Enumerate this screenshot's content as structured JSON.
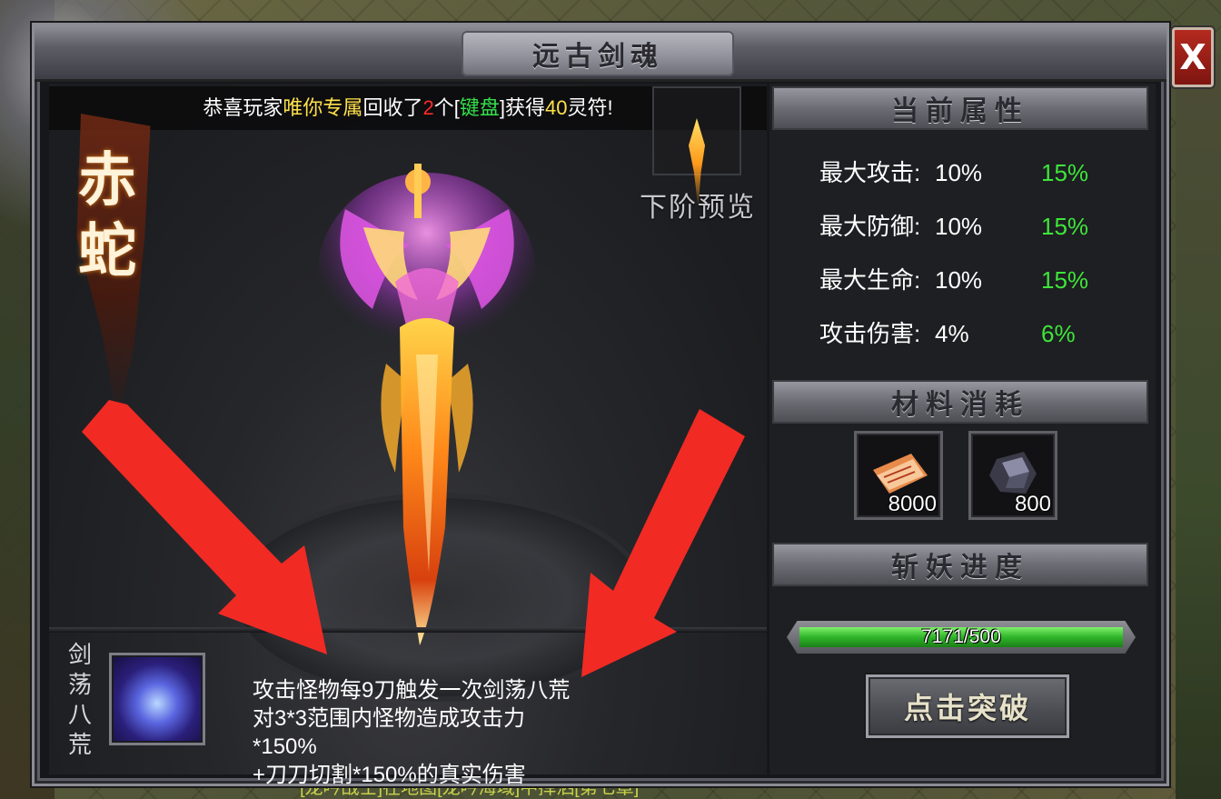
{
  "window": {
    "title": "远古剑魂",
    "close_label": "X"
  },
  "announcement": {
    "prefix": "恭喜玩家",
    "player": "唯你专属",
    "middle": "回收了",
    "count": "2",
    "unit": "个[",
    "item": "键盘",
    "after_item": "]获得",
    "reward": "40",
    "suffix": "灵符!"
  },
  "weapon": {
    "name_line1": "赤",
    "name_line2": "蛇"
  },
  "preview": {
    "label": "下阶预览"
  },
  "skill": {
    "name": "剑荡八荒",
    "description": [
      "攻击怪物每9刀触发一次剑荡八荒",
      "对3*3范围内怪物造成攻击力",
      "*150%",
      "+刀刀切割*150%的真实伤害"
    ]
  },
  "attributes": {
    "header": "当前属性",
    "rows": [
      {
        "label": "最大攻击:",
        "current": "10%",
        "next": "15%"
      },
      {
        "label": "最大防御:",
        "current": "10%",
        "next": "15%"
      },
      {
        "label": "最大生命:",
        "current": "10%",
        "next": "15%"
      },
      {
        "label": "攻击伤害:",
        "current": "4%",
        "next": "6%"
      }
    ]
  },
  "materials": {
    "header": "材料消耗",
    "items": [
      {
        "icon": "scroll-icon",
        "count": "8000"
      },
      {
        "icon": "ore-icon",
        "count": "800"
      }
    ]
  },
  "progress": {
    "header": "斩妖进度",
    "text": "7171/500",
    "fill_fraction": 1.0
  },
  "actions": {
    "break_label": "点击突破"
  },
  "world": {
    "chat_text": "[龙吟战士]在地图[龙吟海域]中挥洒[第七章]"
  },
  "colors": {
    "highlight_yellow": "#ffe14a",
    "highlight_red": "#ff2a2a",
    "highlight_green": "#33e04a",
    "next_value_green": "#3ee53a",
    "arrow_red": "#f22a24"
  }
}
